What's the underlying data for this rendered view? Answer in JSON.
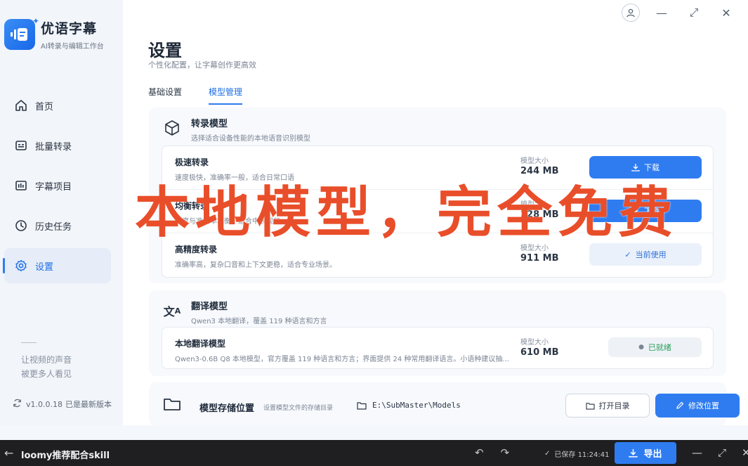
{
  "app": {
    "name": "优语字幕",
    "subtitle": "AI转录与编辑工作台"
  },
  "nav": [
    {
      "label": "首页",
      "icon": "home-icon"
    },
    {
      "label": "批量转录",
      "icon": "batch-icon"
    },
    {
      "label": "字幕项目",
      "icon": "subtitle-project-icon"
    },
    {
      "label": "历史任务",
      "icon": "history-icon"
    },
    {
      "label": "设置",
      "icon": "gear-icon",
      "active": true
    }
  ],
  "slogan": {
    "line1": "让视频的声音",
    "line2": "被更多人看见"
  },
  "version": {
    "number": "v1.0.0.18",
    "status": "已是最新版本"
  },
  "page": {
    "title": "设置",
    "subtitle": "个性化配置，让字幕创作更高效",
    "tabs": [
      {
        "label": "基础设置"
      },
      {
        "label": "模型管理",
        "active": true
      }
    ]
  },
  "transcribe": {
    "title": "转录模型",
    "desc": "选择适合设备性能的本地语音识别模型",
    "size_label": "模型大小",
    "models": [
      {
        "name": "极速转录",
        "desc": "速度极快，准确率一般，适合日常口语",
        "size": "244 MB",
        "action": "下载"
      },
      {
        "name": "均衡转录",
        "desc": "速度与准确率均衡，适合中长视频",
        "size": "228 MB",
        "action": "下载"
      },
      {
        "name": "高精度转录",
        "desc": "准确率高，复杂口音和上下文更稳，适合专业场景。",
        "size": "911 MB",
        "action": "当前使用"
      }
    ]
  },
  "translate": {
    "title": "翻译模型",
    "desc": "Qwen3 本地翻译，覆盖 119 种语言和方言",
    "model": {
      "name": "本地翻译模型",
      "desc": "Qwen3-0.6B Q8 本地模型，官方覆盖 119 种语言和方言；界面提供 24 种常用翻译语言。小语种建议抽...",
      "size_label": "模型大小",
      "size": "610 MB",
      "status": "已就绪"
    }
  },
  "storage": {
    "title": "模型存储位置",
    "desc": "设置模型文件的存储目录",
    "path": "E:\\SubMaster\\Models",
    "open_label": "打开目录",
    "change_label": "修改位置"
  },
  "overlay_text": "本地模型，完全免费",
  "bottombar": {
    "title": "loomy推荐配合skill",
    "saved": "已保存 11:24:41",
    "export_label": "导出"
  },
  "colors": {
    "accent": "#2f7cf0",
    "overlay": "#e94e2a",
    "ready": "#2a9d5a"
  }
}
